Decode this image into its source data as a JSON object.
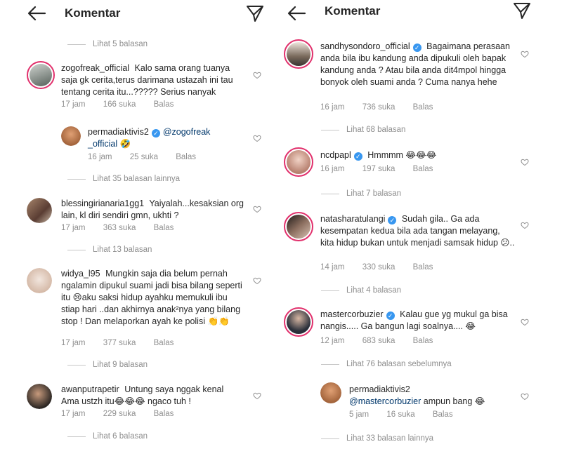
{
  "header": {
    "title": "Komentar",
    "back_icon": "arrow-left-icon",
    "send_icon": "paper-plane-icon"
  },
  "labels": {
    "likes_suffix": "suka",
    "reply": "Balas"
  },
  "left": {
    "view_top": "Lihat 5 balasan",
    "c1": {
      "user": "zogofreak_official",
      "text": "Kalo sama orang tuanya saja gk cerita,terus darimana ustazah ini tau tentang cerita itu...????? Serius nanyak",
      "time": "17 jam",
      "likes": "166 suka"
    },
    "r1": {
      "user": "permadiaktivis2",
      "mention": "@zogofreak _official",
      "emoji": "🤣",
      "time": "16 jam",
      "likes": "25 suka"
    },
    "view1": "Lihat 35 balasan lainnya",
    "c2": {
      "user": "blessingirianaria1gg1",
      "text": "Yaiyalah...kesaksian org lain, kl diri sendiri gmn, ukhti ?",
      "time": "17 jam",
      "likes": "363 suka"
    },
    "view2": "Lihat 13 balasan",
    "c3": {
      "user": "widya_l95",
      "text": "Mungkin saja dia belum pernah ngalamin dipukul suami jadi bisa bilang seperti itu 😢aku saksi hidup ayahku memukuli ibu stiap hari ..dan akhirnya anak²nya yang bilang stop ! Dan melaporkan ayah ke polisi 👏👏",
      "time": "17 jam",
      "likes": "377 suka"
    },
    "view3": "Lihat 9 balasan",
    "c4": {
      "user": "awanputrapetir",
      "text": "Untung saya nggak kenal Ama ustzh itu😂😂😂 ngaco tuh !",
      "time": "17 jam",
      "likes": "229 suka"
    },
    "view4": "Lihat 6 balasan"
  },
  "right": {
    "c1": {
      "user": "sandhysondoro_official",
      "text": "Bagaimana perasaan anda bila ibu kandung anda dipukuli oleh bapak kandung anda ? Atau bila anda dit4mpol hingga bonyok oleh suami anda ? Cuma nanya hehe",
      "time": "16 jam",
      "likes": "736 suka"
    },
    "view1": "Lihat 68 balasan",
    "c2": {
      "user": "ncdpapl",
      "text": "Hmmmm 😂😂😂",
      "time": "16 jam",
      "likes": "197 suka"
    },
    "view2": "Lihat 7 balasan",
    "c3": {
      "user": "natasharatulangi",
      "text": "Sudah gila.. Ga ada kesempatan kedua bila ada tangan melayang, kita hidup bukan untuk menjadi samsak hidup 😕..",
      "time": "14 jam",
      "likes": "330 suka"
    },
    "view3": "Lihat 4 balasan",
    "c4": {
      "user": "mastercorbuzier",
      "text": "Kalau gue yg mukul ga bisa nangis..... Ga bangun lagi soalnya.... 😂",
      "time": "12 jam",
      "likes": "683 suka"
    },
    "view4": "Lihat 76 balasan sebelumnya",
    "r1": {
      "user": "permadiaktivis2",
      "mention": "@mastercorbuzier",
      "text": "ampun bang 😂",
      "time": "5 jam",
      "likes": "16 suka"
    },
    "view5": "Lihat 33 balasan lainnya"
  },
  "colors": {
    "link": "#00376b",
    "muted": "#8e8e8e",
    "verified": "#3897f0",
    "story_ring": "#e1306c"
  }
}
